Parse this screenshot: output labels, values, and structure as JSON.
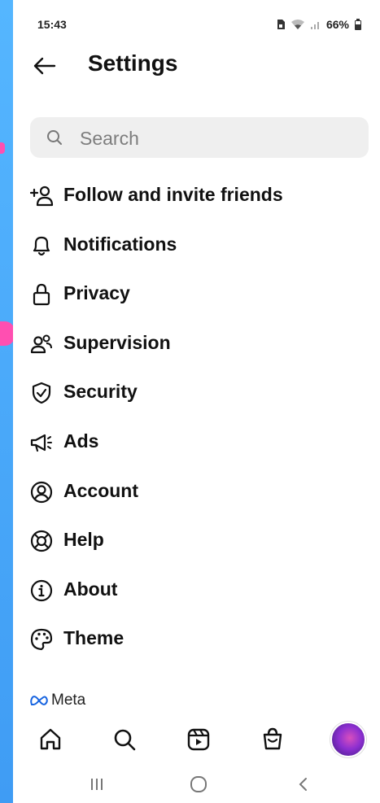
{
  "status_bar": {
    "time": "15:43",
    "battery": "66%"
  },
  "header": {
    "title": "Settings"
  },
  "search": {
    "placeholder": "Search"
  },
  "menu": {
    "items": [
      {
        "label": "Follow and invite friends",
        "icon": "add-person-icon"
      },
      {
        "label": "Notifications",
        "icon": "bell-icon"
      },
      {
        "label": "Privacy",
        "icon": "lock-icon"
      },
      {
        "label": "Supervision",
        "icon": "people-icon"
      },
      {
        "label": "Security",
        "icon": "shield-check-icon"
      },
      {
        "label": "Ads",
        "icon": "megaphone-icon"
      },
      {
        "label": "Account",
        "icon": "account-circle-icon"
      },
      {
        "label": "Help",
        "icon": "lifebuoy-icon"
      },
      {
        "label": "About",
        "icon": "info-icon"
      },
      {
        "label": "Theme",
        "icon": "palette-icon"
      }
    ]
  },
  "footer": {
    "brand": "Meta"
  },
  "bottom_nav": [
    "home-icon",
    "search-icon",
    "reels-icon",
    "shop-icon",
    "profile-avatar"
  ],
  "colors": {
    "background_accent": "#4aaaf9",
    "pink_accent": "#ff4fb1",
    "search_bg": "#efefef",
    "text_primary": "#111111",
    "text_secondary": "#7d7d7d"
  }
}
